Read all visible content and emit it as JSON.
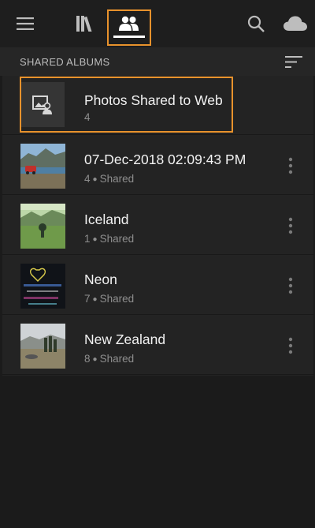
{
  "topbar": {
    "menu_icon": "hamburger-menu-icon",
    "library_icon": "library-books-icon",
    "shared_icon": "people-shared-icon",
    "search_icon": "search-icon",
    "cloud_icon": "cloud-icon"
  },
  "section": {
    "title": "SHARED ALBUMS",
    "sort_icon": "sort-lines-icon"
  },
  "albums": [
    {
      "title": "Photos Shared to Web",
      "count": "4",
      "shared_label": ""
    },
    {
      "title": "07-Dec-2018 02:09:43 PM",
      "count": "4",
      "shared_label": "Shared"
    },
    {
      "title": "Iceland",
      "count": "1",
      "shared_label": "Shared"
    },
    {
      "title": "Neon",
      "count": "7",
      "shared_label": "Shared"
    },
    {
      "title": "New Zealand",
      "count": "8",
      "shared_label": "Shared"
    }
  ],
  "colors": {
    "highlight": "#e8922c",
    "background": "#1b1b1b",
    "row_background": "#232323"
  }
}
